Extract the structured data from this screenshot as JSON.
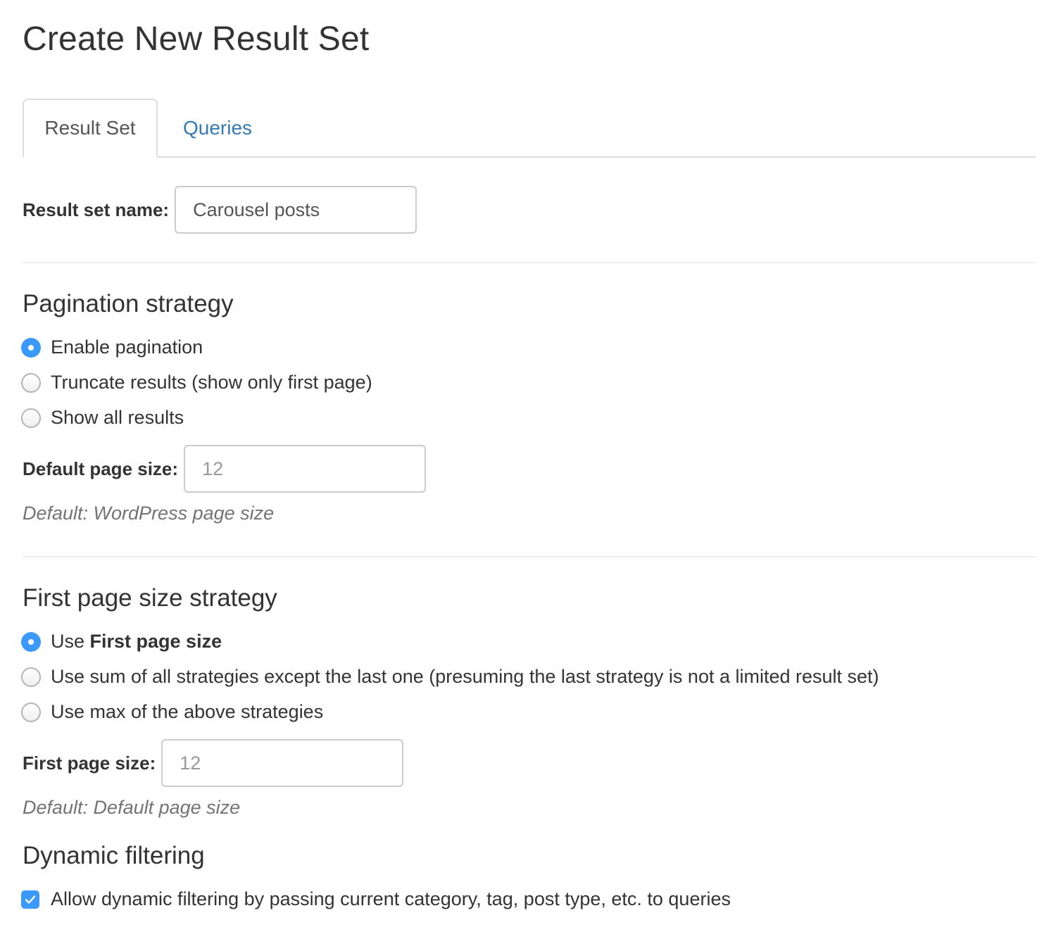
{
  "page": {
    "title": "Create New Result Set"
  },
  "tabs": [
    {
      "label": "Result Set",
      "active": true
    },
    {
      "label": "Queries",
      "active": false
    }
  ],
  "result_set_name": {
    "label": "Result set name:",
    "value": "Carousel posts"
  },
  "pagination": {
    "heading": "Pagination strategy",
    "options": [
      {
        "label": "Enable pagination",
        "checked": true
      },
      {
        "label": "Truncate results (show only first page)",
        "checked": false
      },
      {
        "label": "Show all results",
        "checked": false
      }
    ],
    "page_size_label": "Default page size:",
    "page_size_placeholder": "12",
    "help": "Default: WordPress page size"
  },
  "first_page": {
    "heading": "First page size strategy",
    "options": [
      {
        "label_prefix": "Use ",
        "label_bold": "First page size",
        "checked": true
      },
      {
        "label": "Use sum of all strategies except the last one (presuming the last strategy is not a limited result set)",
        "checked": false
      },
      {
        "label": "Use max of the above strategies",
        "checked": false
      }
    ],
    "page_size_label": "First page size:",
    "page_size_placeholder": "12",
    "help": "Default: Default page size"
  },
  "dynamic_filtering": {
    "heading": "Dynamic filtering",
    "checkbox_label": "Allow dynamic filtering by passing current category, tag, post type, etc. to queries",
    "checked": true
  },
  "colors": {
    "accent": "#3b99fc",
    "link": "#337ab7",
    "text": "#333333",
    "muted": "#737373"
  }
}
